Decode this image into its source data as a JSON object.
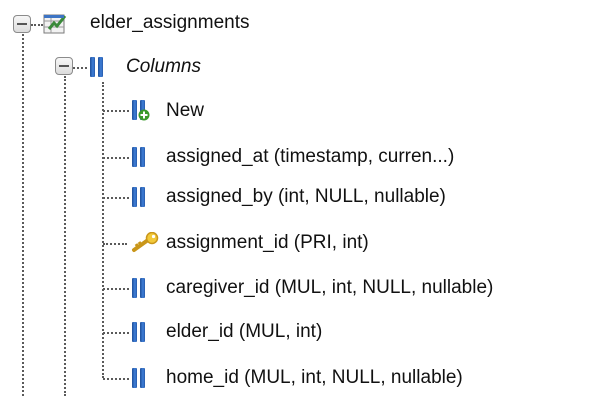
{
  "tree": {
    "table": {
      "label": "elder_assignments",
      "icon": "table-icon"
    },
    "columns_group": {
      "label": "Columns",
      "icon": "columns-icon"
    },
    "items": [
      {
        "label": "New",
        "icon": "new-column-icon"
      },
      {
        "label": "assigned_at (timestamp, curren...)",
        "icon": "column-icon"
      },
      {
        "label": "assigned_by (int, NULL, nullable)",
        "icon": "column-icon"
      },
      {
        "label": "assignment_id (PRI, int)",
        "icon": "primary-key-icon"
      },
      {
        "label": "caregiver_id (MUL, int, NULL, nullable)",
        "icon": "column-icon"
      },
      {
        "label": "elder_id (MUL, int)",
        "icon": "column-icon"
      },
      {
        "label": "home_id (MUL, int, NULL, nullable)",
        "icon": "column-icon"
      }
    ]
  },
  "colors": {
    "column_icon": "#2f6fc8",
    "new_plus": "#3a9a2a",
    "key": "#e0b020",
    "table_green": "#3a8a3a"
  }
}
